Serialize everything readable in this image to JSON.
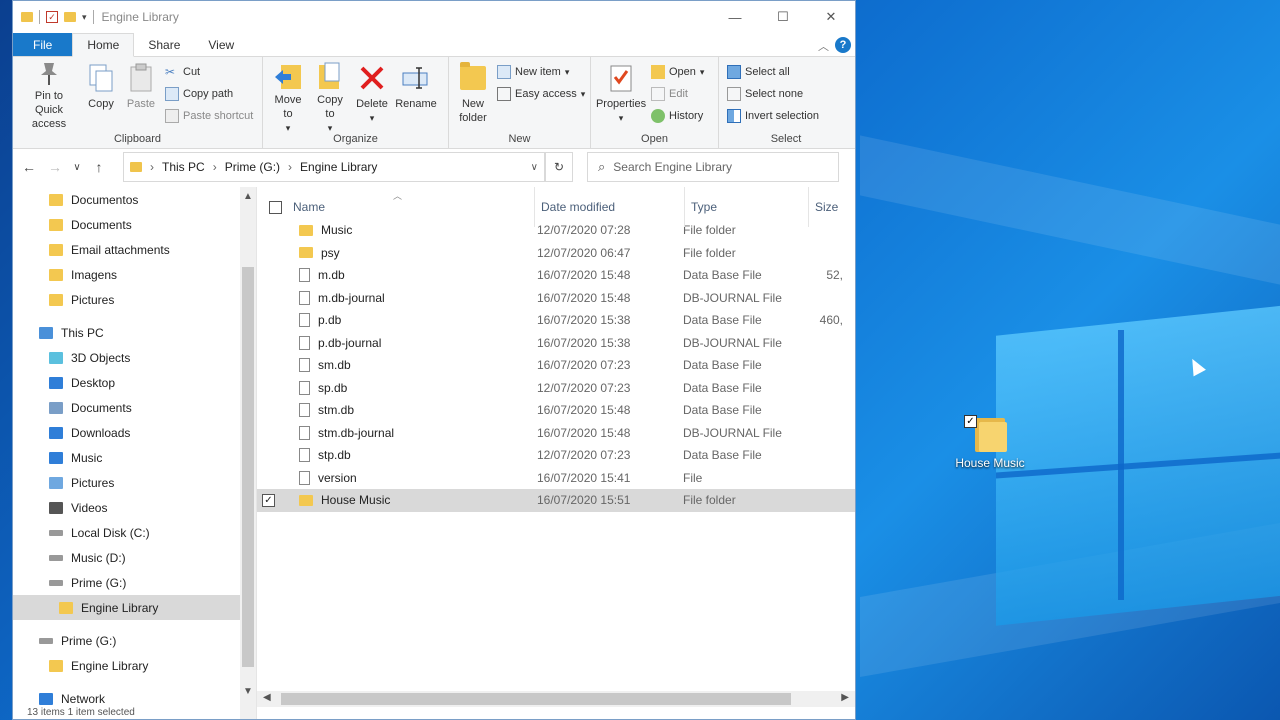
{
  "window": {
    "title": "Engine Library",
    "controls": {
      "minimize": "—",
      "maximize": "☐",
      "close": "✕"
    }
  },
  "tabs": [
    {
      "label": "File"
    },
    {
      "label": "Home"
    },
    {
      "label": "Share"
    },
    {
      "label": "View"
    }
  ],
  "help_label": "?",
  "ribbon": {
    "clipboard": {
      "label": "Clipboard",
      "pin": "Pin to Quick access",
      "copy": "Copy",
      "paste": "Paste",
      "cut": "Cut",
      "copy_path": "Copy path",
      "paste_shortcut": "Paste shortcut"
    },
    "organize": {
      "label": "Organize",
      "move_to": "Move to",
      "copy_to": "Copy to",
      "delete": "Delete",
      "rename": "Rename"
    },
    "new": {
      "label": "New",
      "new_folder": "New folder",
      "new_item": "New item",
      "easy_access": "Easy access"
    },
    "open": {
      "label": "Open",
      "properties": "Properties",
      "open": "Open",
      "edit": "Edit",
      "history": "History"
    },
    "select": {
      "label": "Select",
      "select_all": "Select all",
      "select_none": "Select none",
      "invert": "Invert selection"
    }
  },
  "address": {
    "crumbs": [
      "This PC",
      "Prime (G:)",
      "Engine Library"
    ],
    "search_placeholder": "Search Engine Library"
  },
  "nav": [
    {
      "label": "Documentos",
      "icon": "folder-icon",
      "indent": 2
    },
    {
      "label": "Documents",
      "icon": "folder-icon",
      "indent": 2
    },
    {
      "label": "Email attachments",
      "icon": "folder-icon",
      "indent": 2
    },
    {
      "label": "Imagens",
      "icon": "folder-icon",
      "indent": 2
    },
    {
      "label": "Pictures",
      "icon": "folder-icon",
      "indent": 2
    },
    {
      "label": "",
      "icon": "",
      "indent": 0
    },
    {
      "label": "This PC",
      "icon": "pc-icon",
      "indent": 1
    },
    {
      "label": "3D Objects",
      "icon": "3d-objects-icon",
      "indent": 2
    },
    {
      "label": "Desktop",
      "icon": "desktop-icon",
      "indent": 2
    },
    {
      "label": "Documents",
      "icon": "documents-icon",
      "indent": 2
    },
    {
      "label": "Downloads",
      "icon": "downloads-icon",
      "indent": 2
    },
    {
      "label": "Music",
      "icon": "music-icon",
      "indent": 2
    },
    {
      "label": "Pictures",
      "icon": "pictures-icon",
      "indent": 2
    },
    {
      "label": "Videos",
      "icon": "videos-icon",
      "indent": 2
    },
    {
      "label": "Local Disk (C:)",
      "icon": "drive-icon",
      "indent": 2
    },
    {
      "label": "Music (D:)",
      "icon": "drive-icon",
      "indent": 2
    },
    {
      "label": "Prime (G:)",
      "icon": "drive-icon",
      "indent": 2
    },
    {
      "label": "Engine Library",
      "icon": "folder-icon",
      "indent": 3,
      "selected": true
    },
    {
      "label": "",
      "icon": "",
      "indent": 0
    },
    {
      "label": "Prime (G:)",
      "icon": "drive-icon",
      "indent": 1
    },
    {
      "label": "Engine Library",
      "icon": "folder-icon",
      "indent": 2
    },
    {
      "label": "",
      "icon": "",
      "indent": 0
    },
    {
      "label": "Network",
      "icon": "network-icon",
      "indent": 1
    }
  ],
  "columns": {
    "name": "Name",
    "date": "Date modified",
    "type": "Type",
    "size": "Size"
  },
  "files": [
    {
      "name": "Music",
      "date": "12/07/2020 07:28",
      "type": "File folder",
      "size": "",
      "kind": "folder"
    },
    {
      "name": "psy",
      "date": "12/07/2020 06:47",
      "type": "File folder",
      "size": "",
      "kind": "folder"
    },
    {
      "name": "m.db",
      "date": "16/07/2020 15:48",
      "type": "Data Base File",
      "size": "52,",
      "kind": "file"
    },
    {
      "name": "m.db-journal",
      "date": "16/07/2020 15:48",
      "type": "DB-JOURNAL File",
      "size": "",
      "kind": "file"
    },
    {
      "name": "p.db",
      "date": "16/07/2020 15:38",
      "type": "Data Base File",
      "size": "460,",
      "kind": "file"
    },
    {
      "name": "p.db-journal",
      "date": "16/07/2020 15:38",
      "type": "DB-JOURNAL File",
      "size": "",
      "kind": "file"
    },
    {
      "name": "sm.db",
      "date": "16/07/2020 07:23",
      "type": "Data Base File",
      "size": "",
      "kind": "file"
    },
    {
      "name": "sp.db",
      "date": "12/07/2020 07:23",
      "type": "Data Base File",
      "size": "",
      "kind": "file"
    },
    {
      "name": "stm.db",
      "date": "16/07/2020 15:48",
      "type": "Data Base File",
      "size": "",
      "kind": "file"
    },
    {
      "name": "stm.db-journal",
      "date": "16/07/2020 15:48",
      "type": "DB-JOURNAL File",
      "size": "",
      "kind": "file"
    },
    {
      "name": "stp.db",
      "date": "12/07/2020 07:23",
      "type": "Data Base File",
      "size": "",
      "kind": "file"
    },
    {
      "name": "version",
      "date": "16/07/2020 15:41",
      "type": "File",
      "size": "",
      "kind": "file"
    },
    {
      "name": "House Music",
      "date": "16/07/2020 15:51",
      "type": "File folder",
      "size": "",
      "kind": "folder",
      "selected": true
    }
  ],
  "status": "13 items    1 item selected",
  "desktop": {
    "icon_label": "House Music"
  },
  "colors": {
    "accent": "#1979ca",
    "folder": "#f3c850",
    "selection": "#d9d9d9"
  }
}
